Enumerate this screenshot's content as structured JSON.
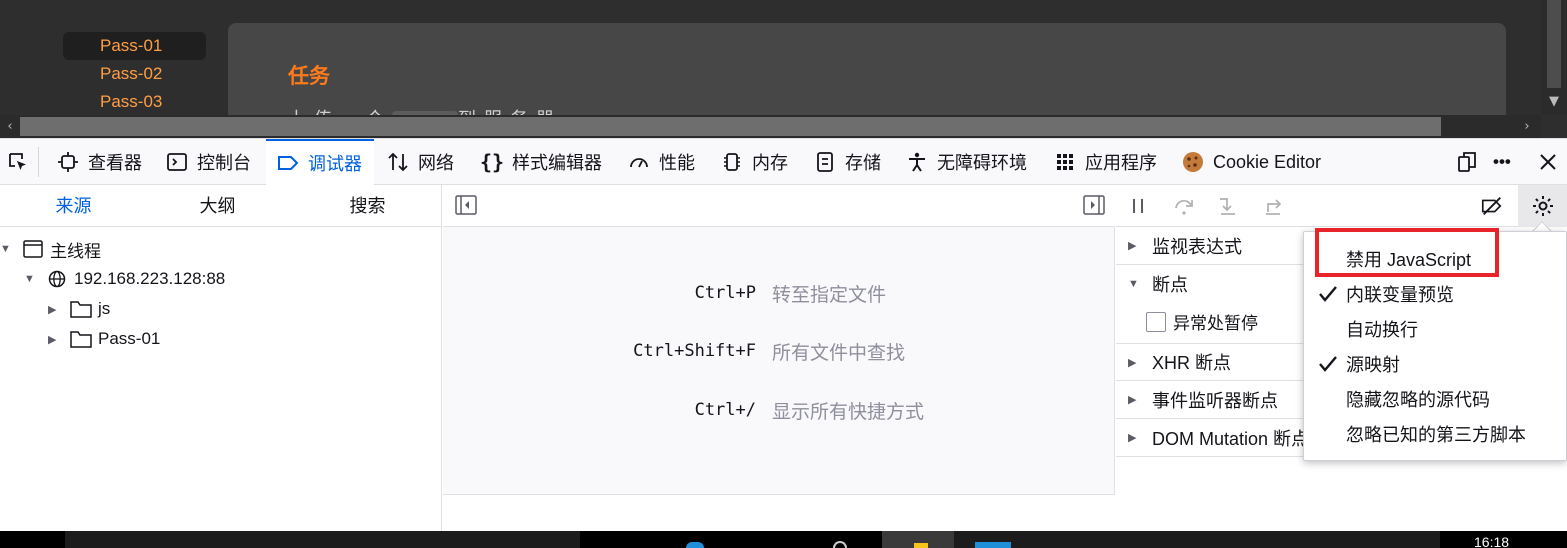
{
  "webpage": {
    "pass_links": [
      "Pass-01",
      "Pass-02",
      "Pass-03"
    ],
    "task_title": "任务",
    "task_text_start": "上传一个",
    "task_text_end": "到服务器"
  },
  "toolbar": {
    "tabs": [
      {
        "label": "查看器",
        "icon": "inspector-icon"
      },
      {
        "label": "控制台",
        "icon": "console-icon"
      },
      {
        "label": "调试器",
        "icon": "debugger-icon"
      },
      {
        "label": "网络",
        "icon": "network-icon"
      },
      {
        "label": "样式编辑器",
        "icon": "style-editor-icon"
      },
      {
        "label": "性能",
        "icon": "performance-icon"
      },
      {
        "label": "内存",
        "icon": "memory-icon"
      },
      {
        "label": "存储",
        "icon": "storage-icon"
      },
      {
        "label": "无障碍环境",
        "icon": "accessibility-icon"
      },
      {
        "label": "应用程序",
        "icon": "application-icon"
      },
      {
        "label": "Cookie Editor",
        "icon": "cookie-icon"
      }
    ],
    "selected_tab": "调试器",
    "more_label": "•••"
  },
  "sources": {
    "tabs": [
      "来源",
      "大纲",
      "搜索"
    ],
    "tree": {
      "thread": "主线程",
      "host": "192.168.223.128:88",
      "folders": [
        "js",
        "Pass-01"
      ]
    }
  },
  "editor": {
    "shortcuts": [
      {
        "key": "Ctrl+P",
        "desc": "转至指定文件"
      },
      {
        "key": "Ctrl+Shift+F",
        "desc": "所有文件中查找"
      },
      {
        "key": "Ctrl+/",
        "desc": "显示所有快捷方式"
      }
    ]
  },
  "debugger": {
    "sections": {
      "watch": "监视表达式",
      "breakpoints": "断点",
      "pause_on_exceptions": "异常处暂停",
      "xhr": "XHR 断点",
      "event_listeners": "事件监听器断点",
      "dom_mutation": "DOM Mutation 断点"
    }
  },
  "settings_menu": {
    "items": [
      {
        "label": "禁用 JavaScript",
        "checked": false
      },
      {
        "label": "内联变量预览",
        "checked": true
      },
      {
        "label": "自动换行",
        "checked": false
      },
      {
        "label": "源映射",
        "checked": true
      },
      {
        "label": "隐藏忽略的源代码",
        "checked": false
      },
      {
        "label": "忽略已知的第三方脚本",
        "checked": false
      }
    ]
  },
  "taskbar": {
    "clock": "16:18"
  },
  "colors": {
    "accent": "#0061e0",
    "highlight": "#e8232a",
    "pass_link": "#ff9f43",
    "task_title": "#ff7a1a"
  }
}
